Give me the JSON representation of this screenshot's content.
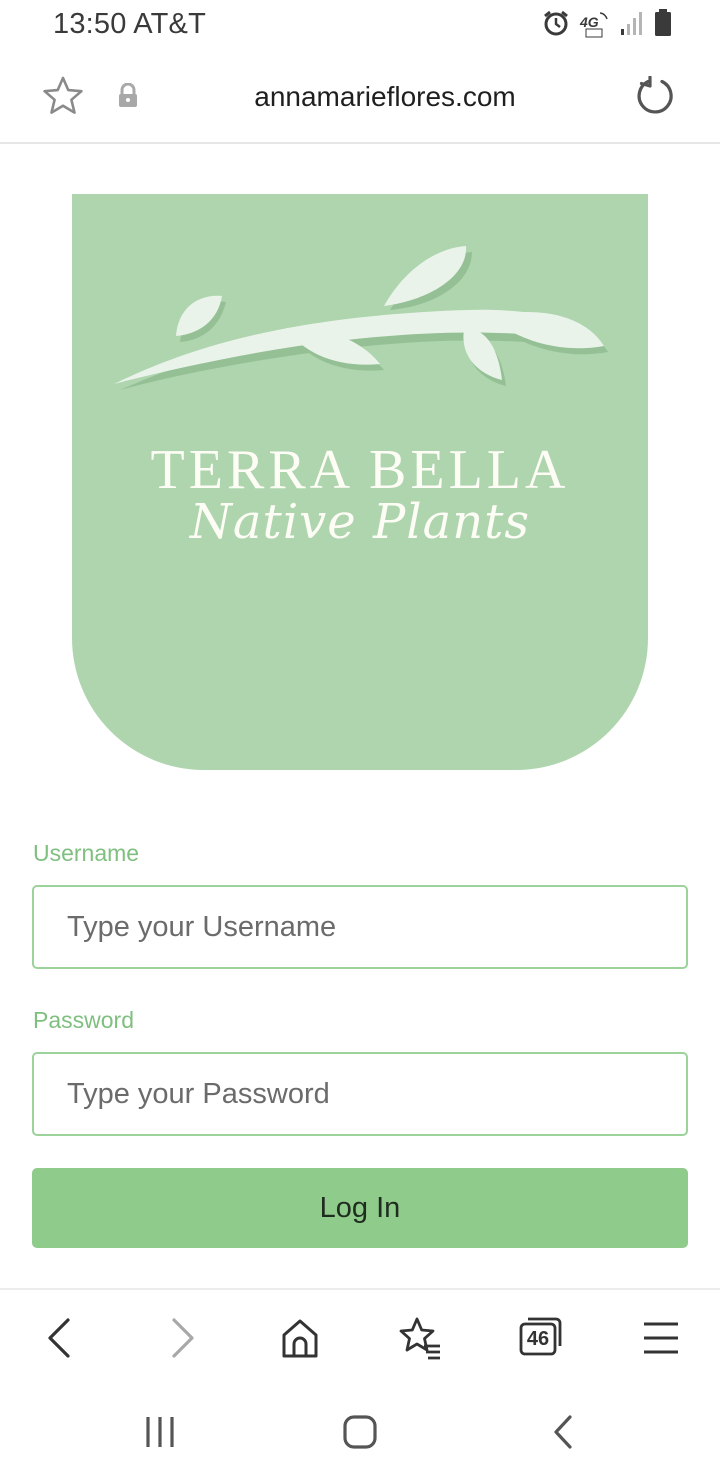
{
  "status_bar": {
    "time_carrier": "13:50 AT&T",
    "icons": [
      "alarm-icon",
      "4g-lte-icon",
      "signal-icon",
      "battery-icon"
    ],
    "network_label": "4G"
  },
  "browser": {
    "url": "annamarieflores.com",
    "icons": [
      "bookmark-star-icon",
      "lock-icon",
      "reload-icon"
    ]
  },
  "logo": {
    "brand": "TERRA BELLA",
    "tagline": "Native Plants",
    "background_color": "#aed5ae"
  },
  "login_form": {
    "username_label": "Username",
    "username_placeholder": "Type your Username",
    "username_value": "",
    "password_label": "Password",
    "password_placeholder": "Type your Password",
    "password_value": "",
    "login_button": "Log In",
    "accent_color": "#8fcb8b"
  },
  "browser_toolbar": {
    "tab_count": "46",
    "icons": [
      "back-icon",
      "forward-icon",
      "home-icon",
      "bookmarks-icon",
      "tabs-icon",
      "menu-icon"
    ]
  },
  "nav_bar": {
    "icons": [
      "recent-apps-icon",
      "home-circle-icon",
      "nav-back-icon"
    ]
  }
}
